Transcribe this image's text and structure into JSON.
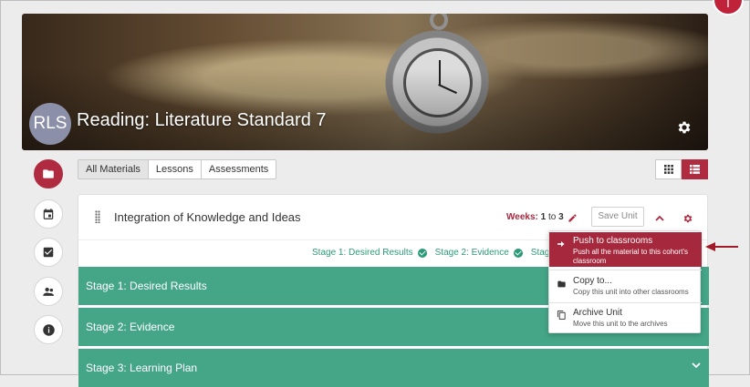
{
  "header": {
    "user_initial": "T"
  },
  "banner": {
    "avatar_initials": "RLS",
    "title": "Reading: Literature Standard 7"
  },
  "left_rail": [
    {
      "name": "materials",
      "icon": "folder-icon",
      "active": true
    },
    {
      "name": "calendar",
      "icon": "calendar-icon",
      "active": false
    },
    {
      "name": "tasks",
      "icon": "checkbox-icon",
      "active": false
    },
    {
      "name": "people",
      "icon": "people-icon",
      "active": false
    },
    {
      "name": "info",
      "icon": "info-icon",
      "active": false
    }
  ],
  "tabs": [
    {
      "label": "All Materials",
      "active": true
    },
    {
      "label": "Lessons",
      "active": false
    },
    {
      "label": "Assessments",
      "active": false
    }
  ],
  "view_toggle": {
    "options": [
      "grid",
      "list"
    ],
    "selected": "list"
  },
  "unit": {
    "title": "Integration of Knowledge and Ideas",
    "weeks_label": "Weeks:",
    "weeks_from": "1",
    "weeks_to_word": "to",
    "weeks_to": "3",
    "save_button": "Save Unit",
    "stage_links": [
      "Stage 1: Desired Results",
      "Stage 2: Evidence",
      "Stage"
    ],
    "stages": [
      "Stage 1: Desired Results",
      "Stage 2: Evidence",
      "Stage 3: Learning Plan"
    ]
  },
  "menu": {
    "items": [
      {
        "label": "Push to classrooms",
        "description": "Push all the material to this cohort's classroom",
        "icon": "arrow-right-icon",
        "active": true
      },
      {
        "label": "Copy to...",
        "description": "Copy this unit into other classrooms",
        "icon": "folder-icon",
        "active": false
      },
      {
        "label": "Archive Unit",
        "description": "Move this unit to the archives",
        "icon": "copy-icon",
        "active": false
      }
    ]
  },
  "colors": {
    "accent": "#b02a40",
    "stage_green": "#45a587",
    "link_green": "#2a9a77"
  }
}
